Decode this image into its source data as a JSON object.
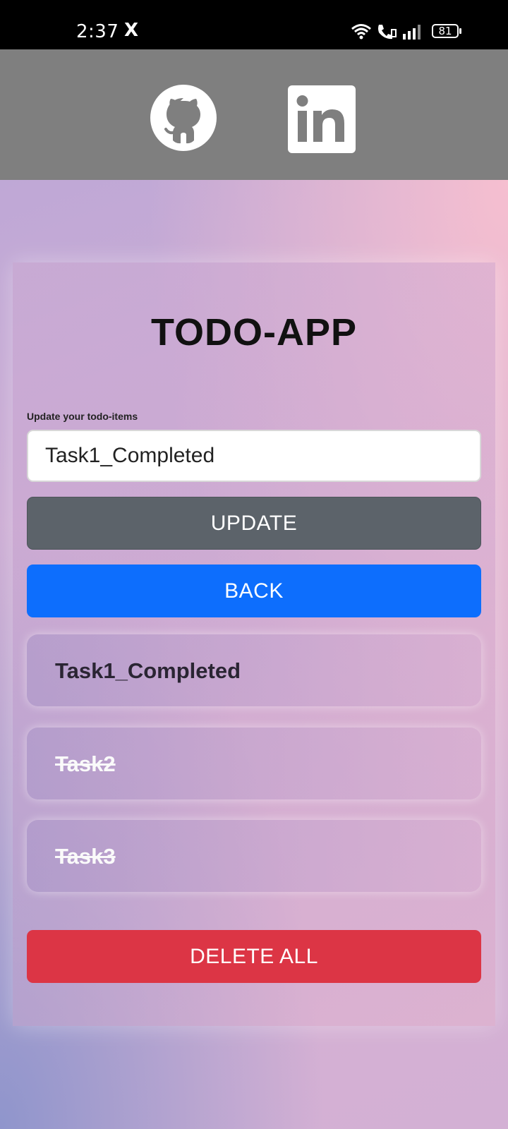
{
  "status_bar": {
    "time": "2:37",
    "notification_app": "X",
    "icons": [
      "wifi-icon",
      "wifi-calling-icon",
      "signal-icon"
    ],
    "battery": "81"
  },
  "social": {
    "icons": [
      "github-icon",
      "linkedin-icon"
    ],
    "colors": {
      "background": "#7f7f7f",
      "icon": "#ffffff"
    }
  },
  "app": {
    "title": "TODO-APP",
    "input_label": "Update your todo-items",
    "input_value": "Task1_Completed",
    "update_label": "UPDATE",
    "back_label": "BACK",
    "delete_all_label": "DELETE ALL",
    "todos": [
      {
        "text": "Task1_Completed",
        "completed": false
      },
      {
        "text": "Task2",
        "completed": true
      },
      {
        "text": "Task3",
        "completed": true
      }
    ],
    "colors": {
      "update": "#5c636a",
      "back": "#0d6efd",
      "delete": "#dc3545"
    }
  }
}
